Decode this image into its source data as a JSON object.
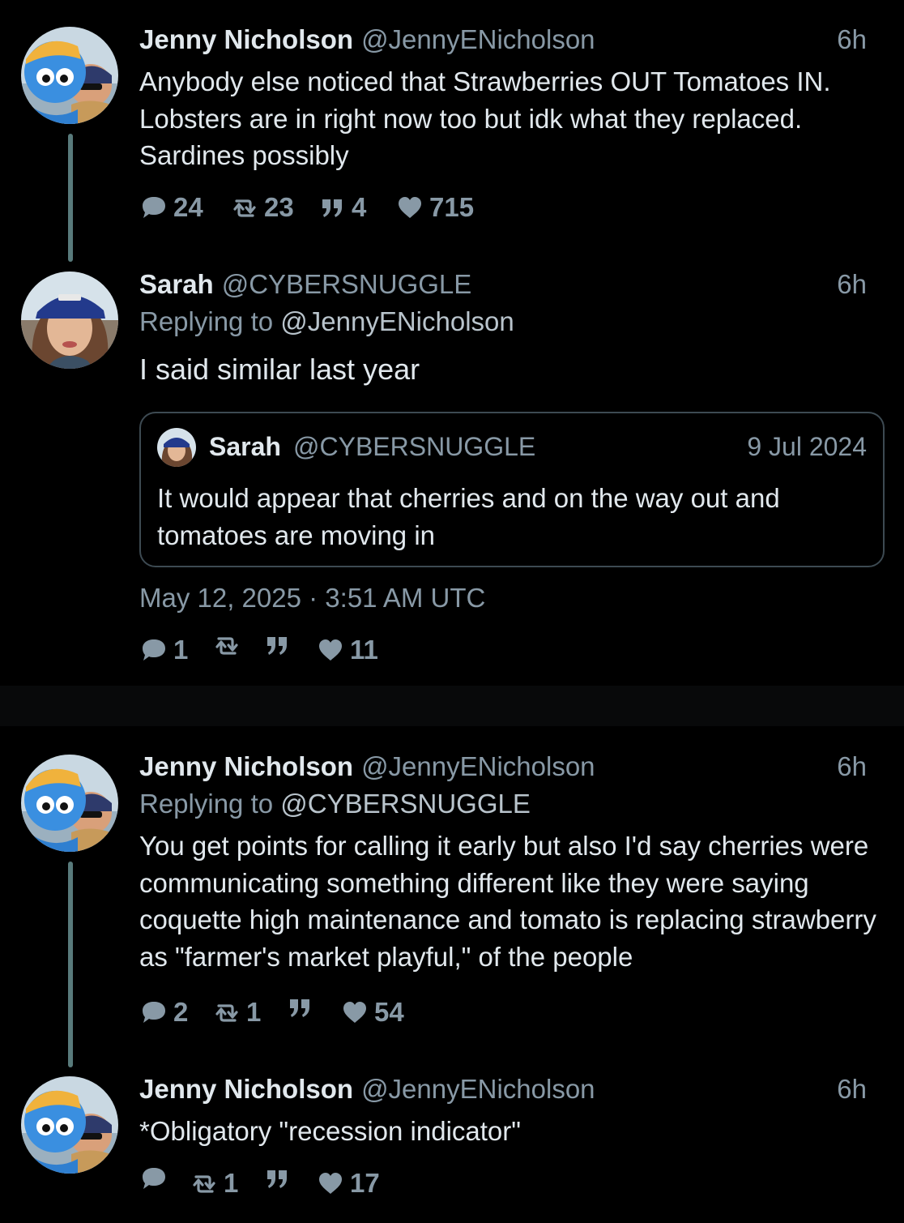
{
  "tweets": [
    {
      "author": "Jenny Nicholson",
      "handle": "@JennyENicholson",
      "time": "6h",
      "text": "Anybody else noticed that Strawberries OUT Tomatoes IN. Lobsters are in right now too but idk what they replaced. Sardines possibly",
      "stats": {
        "replies": "24",
        "retweets": "23",
        "quotes": "4",
        "likes": "715"
      }
    },
    {
      "author": "Sarah",
      "handle": "@CYBERSNUGGLE",
      "time": "6h",
      "replying_label": "Replying to",
      "replying_to": "@JennyENicholson",
      "text": "I said similar last year",
      "quote": {
        "author": "Sarah",
        "handle": "@CYBERSNUGGLE",
        "date": "9 Jul 2024",
        "text": "It would appear that cherries and on the way out and tomatoes are moving in"
      },
      "timestamp": "May 12, 2025 · 3:51 AM UTC",
      "stats": {
        "replies": "1",
        "retweets": "",
        "quotes": "",
        "likes": "11"
      }
    },
    {
      "author": "Jenny Nicholson",
      "handle": "@JennyENicholson",
      "time": "6h",
      "replying_label": "Replying to",
      "replying_to": "@CYBERSNUGGLE",
      "text": "You get points for calling it early but also I'd say cherries were communicating something different like they were saying coquette high maintenance and tomato is replacing strawberry as \"farmer's market playful,\" of the people",
      "stats": {
        "replies": "2",
        "retweets": "1",
        "quotes": "",
        "likes": "54"
      }
    },
    {
      "author": "Jenny Nicholson",
      "handle": "@JennyENicholson",
      "time": "6h",
      "text": "*Obligatory \"recession indicator\"",
      "stats": {
        "replies": "",
        "retweets": "1",
        "quotes": "",
        "likes": "17"
      }
    }
  ],
  "icons": {
    "reply": "comment-icon",
    "retweet": "retweet-icon",
    "quote": "quote-icon",
    "like": "heart-icon"
  },
  "colors": {
    "background": "#000000",
    "text": "#e1e8ed",
    "muted": "#8899a6",
    "thread_line": "#587a7b",
    "quote_border": "#3d4a52"
  }
}
